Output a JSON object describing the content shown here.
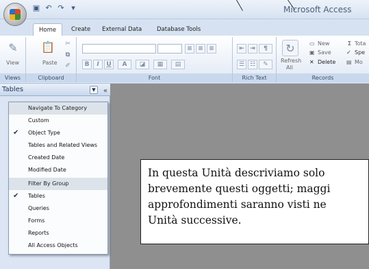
{
  "window": {
    "app_title": "Microsoft Access",
    "qat_icons": [
      "save-icon",
      "undo-icon",
      "redo-icon",
      "customize-icon"
    ]
  },
  "tabs": [
    {
      "label": "Home",
      "active": true
    },
    {
      "label": "Create",
      "active": false
    },
    {
      "label": "External Data",
      "active": false
    },
    {
      "label": "Database Tools",
      "active": false
    }
  ],
  "ribbon": {
    "groups": {
      "views": "Views",
      "clipboard": "Clipboard",
      "font": "Font",
      "rich_text": "Rich Text",
      "records": "Records"
    },
    "buttons": {
      "view": "View",
      "paste": "Paste",
      "refresh": "Refresh",
      "refresh_sub": "All",
      "new": "New",
      "save": "Save",
      "delete": "Delete",
      "totals": "Tota",
      "spelling": "Spe",
      "more": "Mo"
    },
    "font_buttons": [
      "B",
      "I",
      "U",
      "A"
    ]
  },
  "nav_pane": {
    "title": "Tables",
    "collapse_glyph": "«",
    "menu": [
      {
        "label": "Navigate To Category",
        "header": true,
        "checked": false
      },
      {
        "label": "Custom",
        "header": false,
        "checked": false
      },
      {
        "label": "Object Type",
        "header": false,
        "checked": true
      },
      {
        "label": "Tables and Related Views",
        "header": false,
        "checked": false
      },
      {
        "label": "Created Date",
        "header": false,
        "checked": false
      },
      {
        "label": "Modified Date",
        "header": false,
        "checked": false
      },
      {
        "label": "Filter By Group",
        "header": true,
        "checked": false
      },
      {
        "label": "Tables",
        "header": false,
        "checked": true
      },
      {
        "label": "Queries",
        "header": false,
        "checked": false
      },
      {
        "label": "Forms",
        "header": false,
        "checked": false
      },
      {
        "label": "Reports",
        "header": false,
        "checked": false
      },
      {
        "label": "All Access Objects",
        "header": false,
        "checked": false
      }
    ]
  },
  "callout": {
    "lines": [
      "In questa Unità descriviamo solo",
      "brevemente questi oggetti; maggi",
      "approfondimenti saranno visti ne",
      "Unità successive."
    ]
  }
}
